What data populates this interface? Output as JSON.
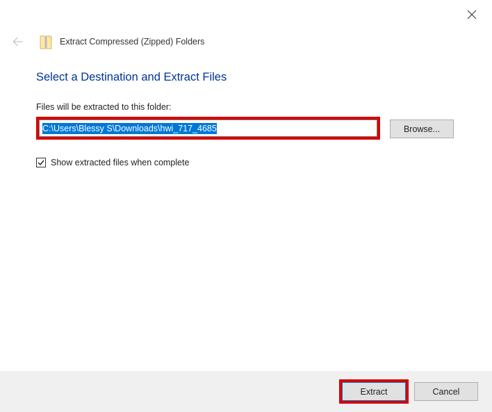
{
  "titlebar": {
    "close_icon": "close"
  },
  "header": {
    "back_icon": "back-arrow",
    "folder_icon": "zipped-folder",
    "wizard_title": "Extract Compressed (Zipped) Folders"
  },
  "content": {
    "heading": "Select a Destination and Extract Files",
    "label_destination": "Files will be extracted to this folder:",
    "path_value": "C:\\Users\\Blessy S\\Downloads\\hwi_717_4685",
    "browse_label": "Browse...",
    "checkbox_show_extracted": {
      "checked": true,
      "label": "Show extracted files when complete"
    }
  },
  "footer": {
    "extract_label": "Extract",
    "cancel_label": "Cancel"
  },
  "annotations": {
    "path_highlight": "red-box",
    "extract_highlight": "red-box"
  }
}
